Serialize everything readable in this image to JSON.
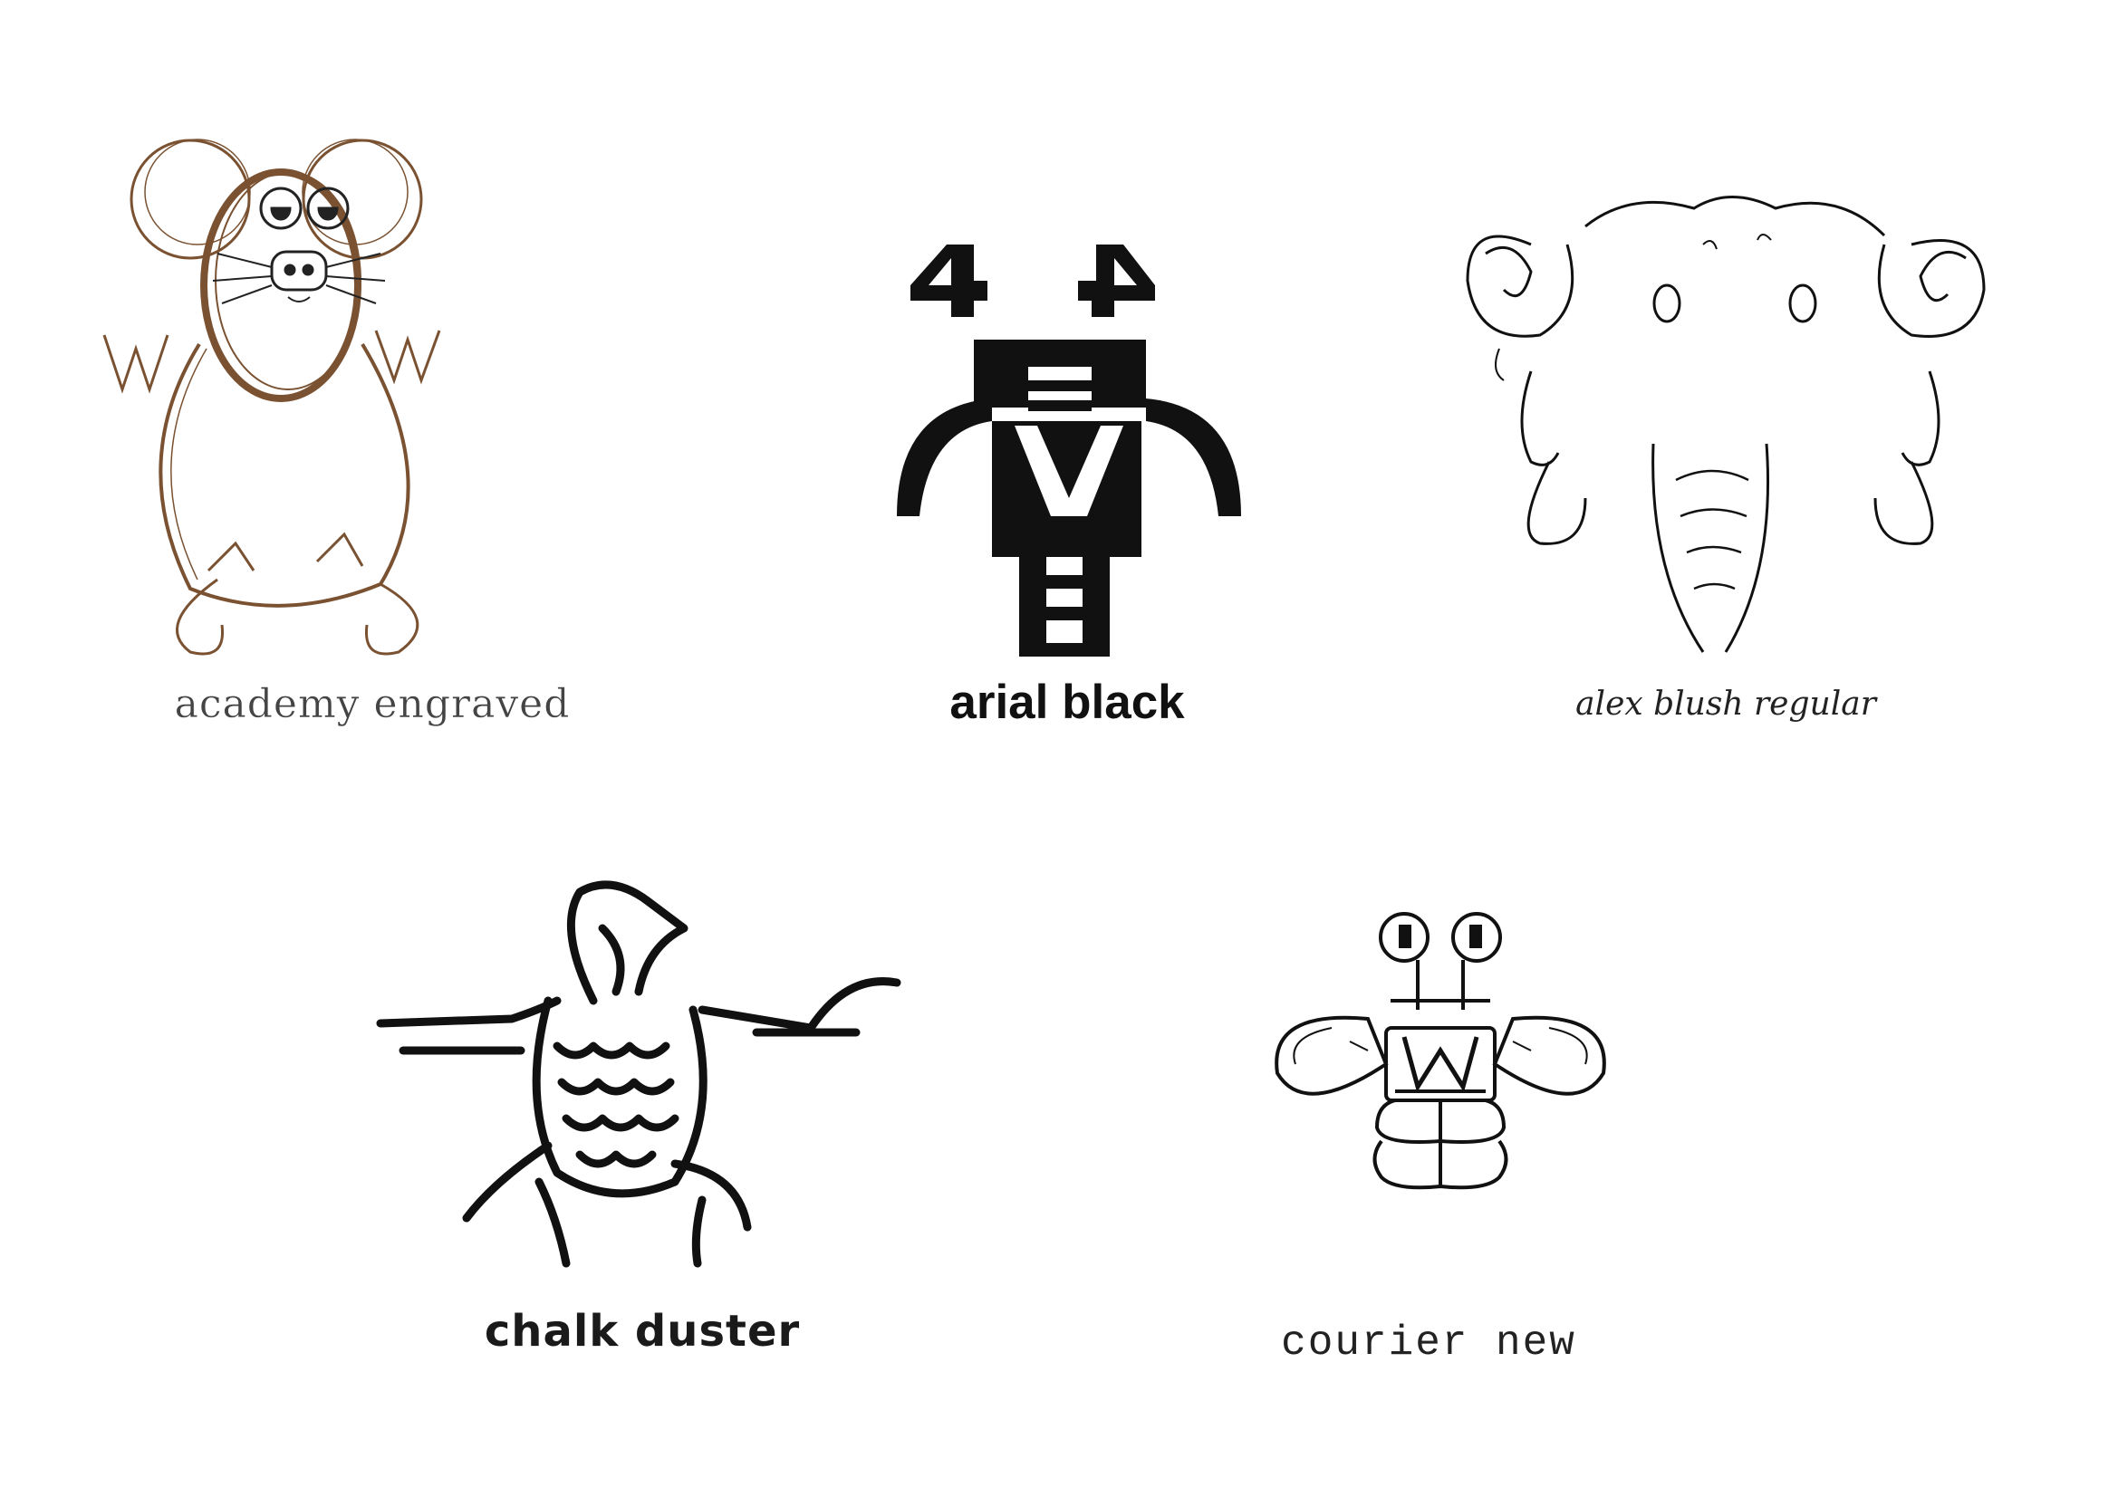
{
  "captions": {
    "academy_engraved": "academy engraved",
    "arial_black": "arial black",
    "alex_blush": "alex blush regular",
    "chalk_duster": "chalk duster",
    "courier_new": "courier new"
  },
  "figures": [
    {
      "id": "mouse",
      "icon": "mouse-icon",
      "color": "#7a5232"
    },
    {
      "id": "robot-totem",
      "icon": "robot-icon",
      "color": "#111111"
    },
    {
      "id": "elephant",
      "icon": "elephant-icon",
      "color": "#111111"
    },
    {
      "id": "bird",
      "icon": "bird-icon",
      "color": "#111111"
    },
    {
      "id": "bee",
      "icon": "bee-icon",
      "color": "#111111"
    }
  ]
}
